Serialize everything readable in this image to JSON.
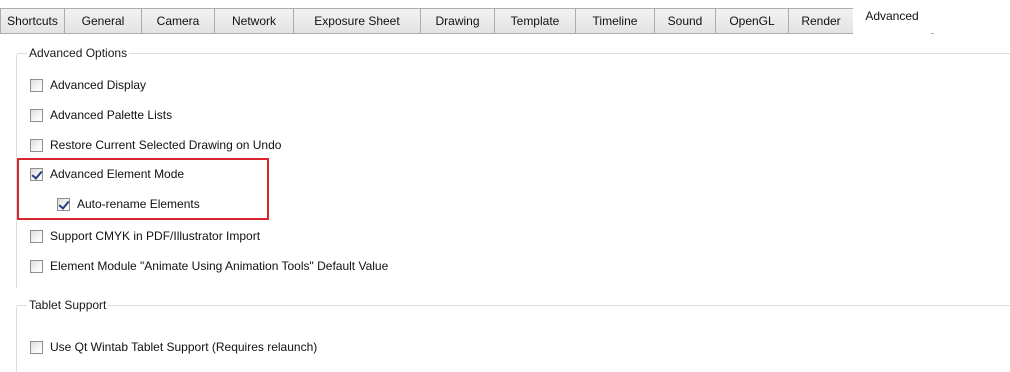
{
  "tabs": [
    {
      "label": "Shortcuts",
      "active": false
    },
    {
      "label": "General",
      "active": false
    },
    {
      "label": "Camera",
      "active": false
    },
    {
      "label": "Network",
      "active": false
    },
    {
      "label": "Exposure Sheet",
      "active": false
    },
    {
      "label": "Drawing",
      "active": false
    },
    {
      "label": "Template",
      "active": false
    },
    {
      "label": "Timeline",
      "active": false
    },
    {
      "label": "Sound",
      "active": false
    },
    {
      "label": "OpenGL",
      "active": false
    },
    {
      "label": "Render",
      "active": false
    },
    {
      "label": "Advanced",
      "active": true
    }
  ],
  "advanced_options": {
    "title": "Advanced Options",
    "items": [
      {
        "label": "Advanced Display",
        "checked": false
      },
      {
        "label": "Advanced Palette Lists",
        "checked": false
      },
      {
        "label": "Restore Current Selected Drawing on Undo",
        "checked": false
      },
      {
        "label": "Advanced Element Mode",
        "checked": true
      },
      {
        "label": "Auto-rename Elements",
        "checked": true
      },
      {
        "label": "Support CMYK in PDF/Illustrator Import",
        "checked": false
      },
      {
        "label": "Element Module \"Animate Using Animation Tools\" Default Value",
        "checked": false
      }
    ]
  },
  "tablet_support": {
    "title": "Tablet Support",
    "items": [
      {
        "label": "Use Qt Wintab Tablet Support (Requires relaunch)",
        "checked": false
      }
    ]
  },
  "colors": {
    "highlight": "#d9262e",
    "checkmark": "#21417c"
  }
}
